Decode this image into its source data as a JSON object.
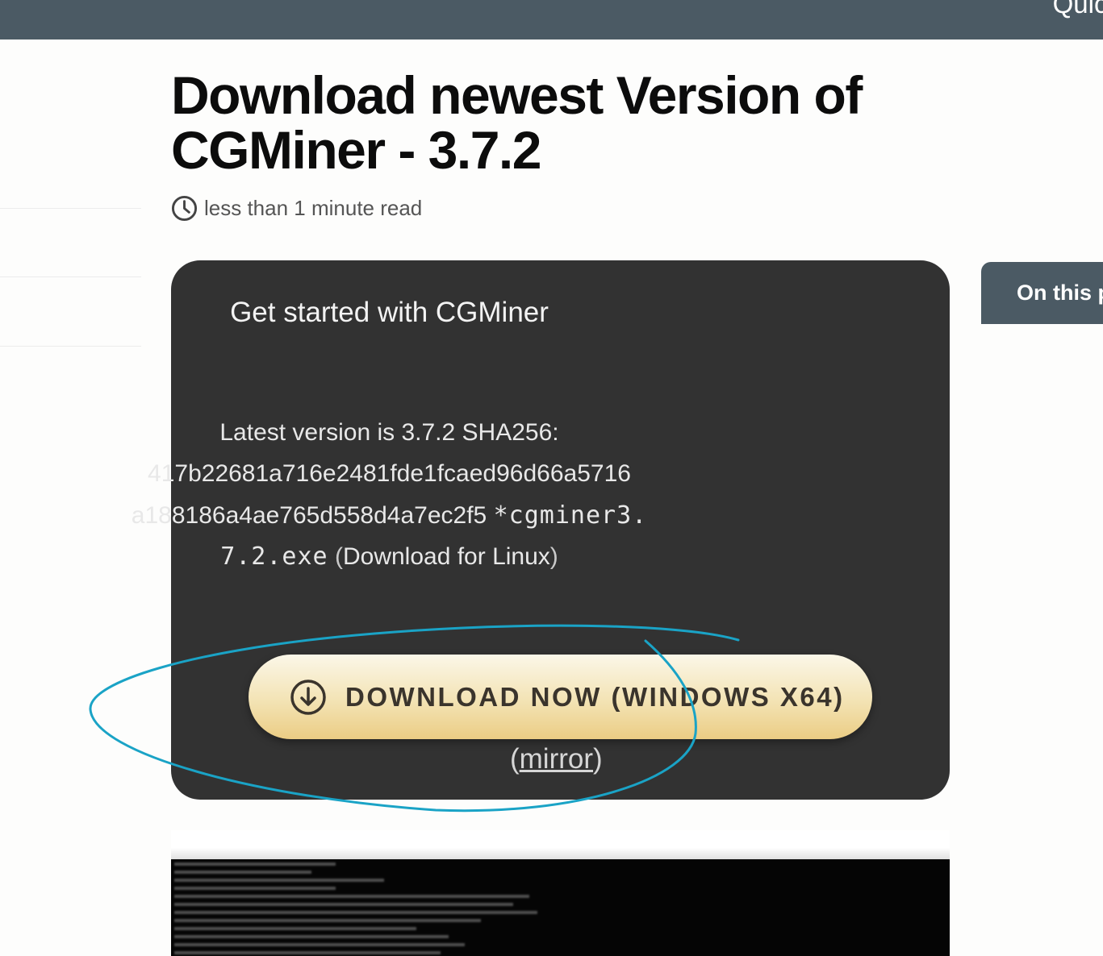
{
  "topbar": {
    "right_text": "Quick"
  },
  "page": {
    "title": "Download newest Version of CGMiner - 3.7.2",
    "read_time": "less than 1 minute read",
    "read_time_icon": "clock-icon"
  },
  "card": {
    "heading": "Get started with CGMiner",
    "latest_prefix": "Latest version is 3.7.2 SHA256:",
    "hash_line_1": "417b22681a716e2481fde1fcaed96d66a5716",
    "hash_line_2": "a188186a4ae765d558d4a7ec2f5",
    "filename_part_1": "*cgminer3.",
    "filename_part_2": "7.2.exe",
    "linux_open": "(",
    "linux_link": "Download for Linux",
    "linux_close": ")",
    "download_button": "DOWNLOAD NOW (WINDOWS X64)",
    "download_icon": "download-circle-icon",
    "mirror_open": "(",
    "mirror_link": "mirror",
    "mirror_close": ")"
  },
  "toc": {
    "label": "On this page",
    "icon": "document-icon"
  },
  "colors": {
    "topbar": "#4b5a64",
    "card_bg": "#323232",
    "button_gold": "#ebcd84",
    "annotation_ring": "#1aa3c6"
  }
}
